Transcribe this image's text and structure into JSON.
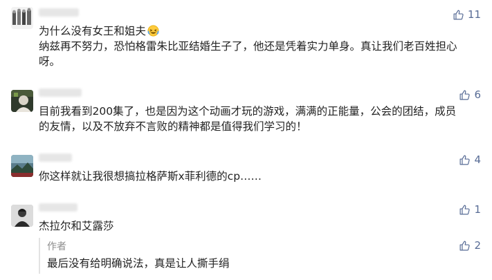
{
  "comments": [
    {
      "text": "为什么没有女王和姐夫",
      "text2": "纳兹再不努力，恐怕格雷朱比亚结婚生子了，他还是凭着实力单身。真让我们老百姓担心呀。",
      "likes": "11",
      "avatar_icon": "group-photo-avatar"
    },
    {
      "text": "目前我看到200集了，也是因为这个动画才玩的游戏，满满的正能量，公会的团结，成员的友情，以及不放弃不言败的精神都是值得我们学习的！",
      "likes": "6",
      "avatar_icon": "portrait-avatar"
    },
    {
      "text": "你这样就让我很想搞拉格萨斯x菲利德的cp……",
      "likes": "4",
      "avatar_icon": "landscape-avatar"
    },
    {
      "text": "杰拉尔和艾露莎",
      "likes": "1",
      "avatar_icon": "character-avatar"
    }
  ],
  "reply": {
    "author": "作者",
    "text": "最后没有给明确说法，真是让人撕手绢",
    "likes": "2"
  },
  "colors": {
    "accent": "#576b95",
    "text": "#222222",
    "meta": "#8c8c8c"
  }
}
